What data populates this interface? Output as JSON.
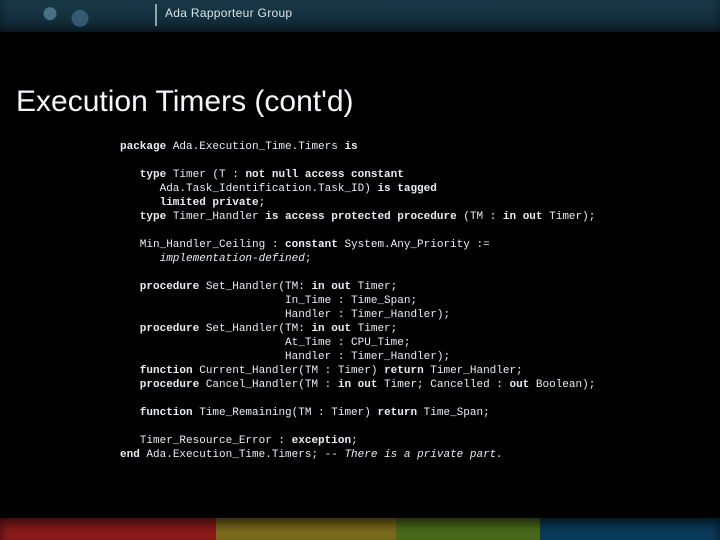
{
  "header": {
    "group": "Ada Rapporteur Group"
  },
  "title": "Execution Timers (cont'd)",
  "code": {
    "l01a": "package",
    "l01b": " Ada.Execution_Time.Timers ",
    "l01c": "is",
    "l03a": "   type",
    "l03b": " Timer (T : ",
    "l03c": "not null access constant",
    "l04a": "      Ada.Task_Identification.Task_ID) ",
    "l04b": "is tagged",
    "l05a": "      limited private",
    "l05b": ";",
    "l06a": "   type",
    "l06b": " Timer_Handler ",
    "l06c": "is access protected procedure",
    "l06d": " (TM : ",
    "l06e": "in out",
    "l06f": " Timer);",
    "l08a": "   Min_Handler_Ceiling : ",
    "l08b": "constant",
    "l08c": " System.Any_Priority :=",
    "l09a": "      ",
    "l09b": "implementation-defined",
    "l09c": ";",
    "l11a": "   procedure",
    "l11b": " Set_Handler(TM: ",
    "l11c": "in out",
    "l11d": " Timer;",
    "l12a": "                         In_Time : Time_Span;",
    "l13a": "                         Handler : Timer_Handler);",
    "l14a": "   procedure",
    "l14b": " Set_Handler(TM: ",
    "l14c": "in out",
    "l14d": " Timer;",
    "l15a": "                         At_Time : CPU_Time;",
    "l16a": "                         Handler : Timer_Handler);",
    "l17a": "   function",
    "l17b": " Current_Handler(TM : Timer) ",
    "l17c": "return",
    "l17d": " Timer_Handler;",
    "l18a": "   procedure",
    "l18b": " Cancel_Handler(TM : ",
    "l18c": "in out",
    "l18d": " Timer; Cancelled : ",
    "l18e": "out",
    "l18f": " Boolean);",
    "l20a": "   function",
    "l20b": " Time_Remaining(TM : Timer) ",
    "l20c": "return",
    "l20d": " Time_Span;",
    "l22a": "   Timer_Resource_Error : ",
    "l22b": "exception",
    "l22c": ";",
    "l23a": "end",
    "l23b": " Ada.Execution_Time.Timers; ",
    "l23c": "-- There is a private part."
  }
}
